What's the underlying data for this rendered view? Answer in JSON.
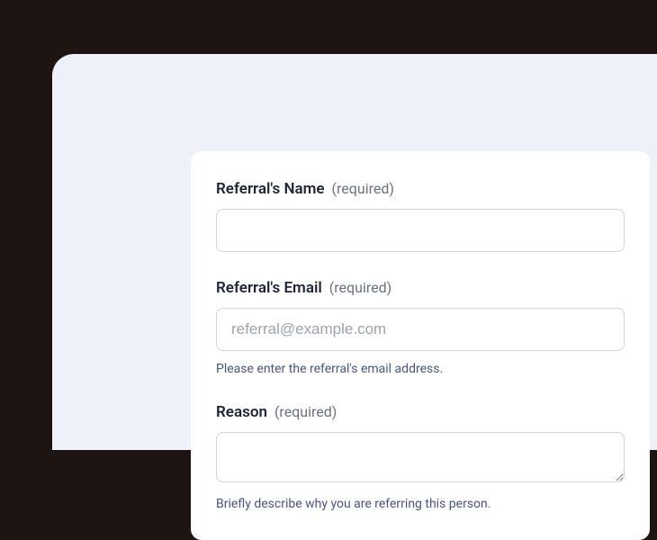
{
  "form": {
    "fields": {
      "name": {
        "label": "Referral's Name",
        "required_text": "(required)",
        "value": "",
        "placeholder": ""
      },
      "email": {
        "label": "Referral's Email",
        "required_text": "(required)",
        "value": "",
        "placeholder": "referral@example.com",
        "helper": "Please enter the referral's email address."
      },
      "reason": {
        "label": "Reason",
        "required_text": "(required)",
        "value": "",
        "helper": "Briefly describe why you are referring this person."
      }
    }
  }
}
